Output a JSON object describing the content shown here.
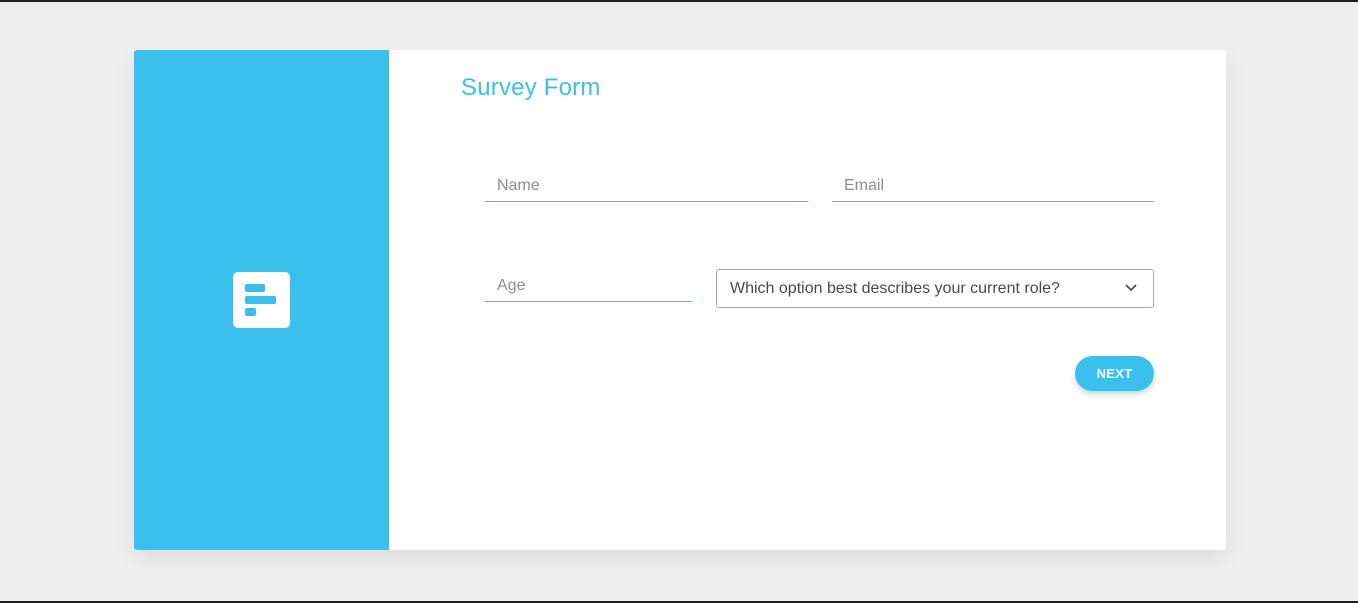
{
  "colors": {
    "accent": "#3bbfec",
    "background": "#efefef",
    "card": "#ffffff"
  },
  "sidebar": {
    "logo_icon": "survey-form-icon"
  },
  "form": {
    "title": "Survey Form",
    "name": {
      "placeholder": "Name",
      "value": ""
    },
    "email": {
      "placeholder": "Email",
      "value": ""
    },
    "age": {
      "placeholder": "Age",
      "value": ""
    },
    "role": {
      "selected": "Which option best describes your current role?",
      "icon": "chevron-down-icon"
    },
    "next_label": "NEXT"
  }
}
